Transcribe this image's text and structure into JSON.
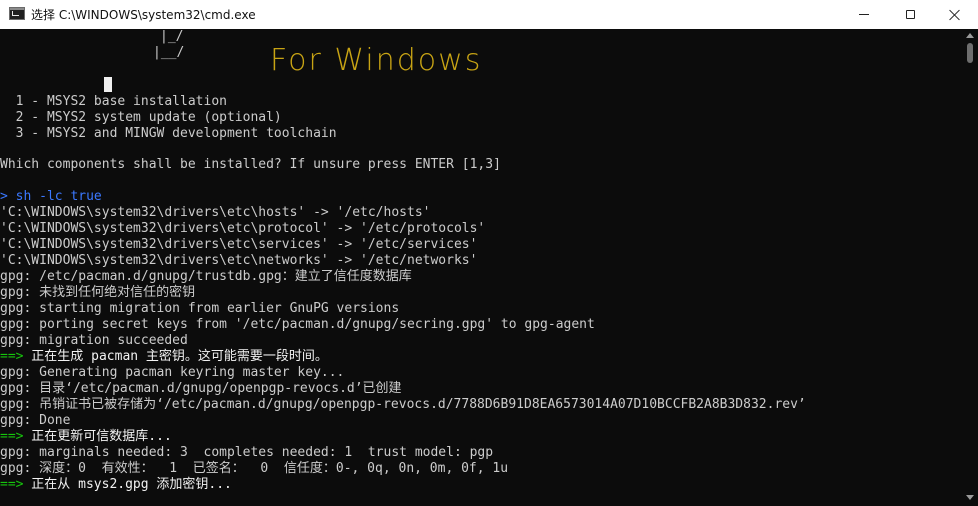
{
  "window": {
    "title": "选择 C:\\WINDOWS\\system32\\cmd.exe",
    "app_icon": "cmd-icon",
    "controls": {
      "minimize_icon": "minimize-icon",
      "maximize_icon": "maximize-icon",
      "close_icon": "close-icon"
    }
  },
  "banner": {
    "art_line_1": "|_/",
    "art_line_2": "|__/",
    "for_windows": "For Windows"
  },
  "menu": {
    "option_1": "  1 - MSYS2 base installation",
    "option_2": "  2 - MSYS2 system update (optional)",
    "option_3": "  3 - MSYS2 and MINGW development toolchain",
    "question": "Which components shall be installed? If unsure press ENTER [1,3]"
  },
  "command": {
    "prompt": ">",
    "text": " sh -lc true"
  },
  "output": {
    "l1": "'C:\\WINDOWS\\system32\\drivers\\etc\\hosts' -> '/etc/hosts'",
    "l2": "'C:\\WINDOWS\\system32\\drivers\\etc\\protocol' -> '/etc/protocols'",
    "l3": "'C:\\WINDOWS\\system32\\drivers\\etc\\services' -> '/etc/services'",
    "l4": "'C:\\WINDOWS\\system32\\drivers\\etc\\networks' -> '/etc/networks'",
    "l5": "gpg: /etc/pacman.d/gnupg/trustdb.gpg：建立了信任度数据库",
    "l6": "gpg: 未找到任何绝对信任的密钥",
    "l7": "gpg: starting migration from earlier GnuPG versions",
    "l8": "gpg: porting secret keys from '/etc/pacman.d/gnupg/secring.gpg' to gpg-agent",
    "l9": "gpg: migration succeeded",
    "l10_arrow": "==>",
    "l10_text": " 正在生成 pacman 主密钥。这可能需要一段时间。",
    "l11": "gpg: Generating pacman keyring master key...",
    "l12": "gpg: 目录‘/etc/pacman.d/gnupg/openpgp-revocs.d’已创建",
    "l13": "gpg: 吊销证书已被存储为‘/etc/pacman.d/gnupg/openpgp-revocs.d/7788D6B91D8EA6573014A07D10BCCFB2A8B3D832.rev’",
    "l14": "gpg: Done",
    "l15_arrow": "==>",
    "l15_text": " 正在更新可信数据库...",
    "l16": "gpg: marginals needed: 3  completes needed: 1  trust model: pgp",
    "l17": "gpg: 深度：0  有效性：  1  已签名：  0  信任度：0-, 0q, 0n, 0m, 0f, 1u",
    "l18_arrow": "==>",
    "l18_text": " 正在从 msys2.gpg 添加密钥..."
  },
  "colors": {
    "background": "#0c0c0c",
    "text": "#cccccc",
    "prompt": "#3b78ff",
    "arrow": "#16c60c",
    "banner": "#c8a414"
  }
}
